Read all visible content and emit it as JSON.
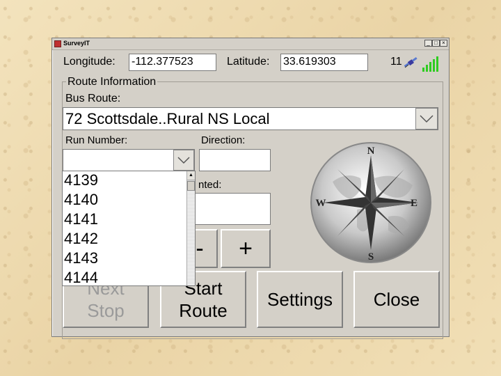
{
  "window": {
    "title": "SurveyIT",
    "minimize_label": "_",
    "maximize_label": "□",
    "close_label": "×"
  },
  "gps": {
    "longitude_label": "Longitude:",
    "longitude_value": "-112.377523",
    "latitude_label": "Latitude:",
    "latitude_value": "33.619303",
    "satellite_count": "11",
    "signal_color": "#2ecc20"
  },
  "route_info": {
    "group_title": "Route Information",
    "bus_route_label": "Bus Route:",
    "bus_route_value": "72 Scottsdale..Rural NS Local",
    "run_number_label": "Run Number:",
    "run_number_value": "",
    "direction_label": "Direction:",
    "direction_value": "",
    "counted_label_partial": "nted:",
    "counted_value": "",
    "run_options": [
      "4139",
      "4140",
      "4141",
      "4142",
      "4143",
      "4144"
    ]
  },
  "counter": {
    "minus_label": "-",
    "plus_label": "+"
  },
  "buttons": {
    "next_stop": "Next Stop",
    "start_route": "Start Route",
    "settings": "Settings",
    "close": "Close"
  },
  "compass": {
    "north": "N",
    "south": "S",
    "east": "E",
    "west": "W"
  }
}
